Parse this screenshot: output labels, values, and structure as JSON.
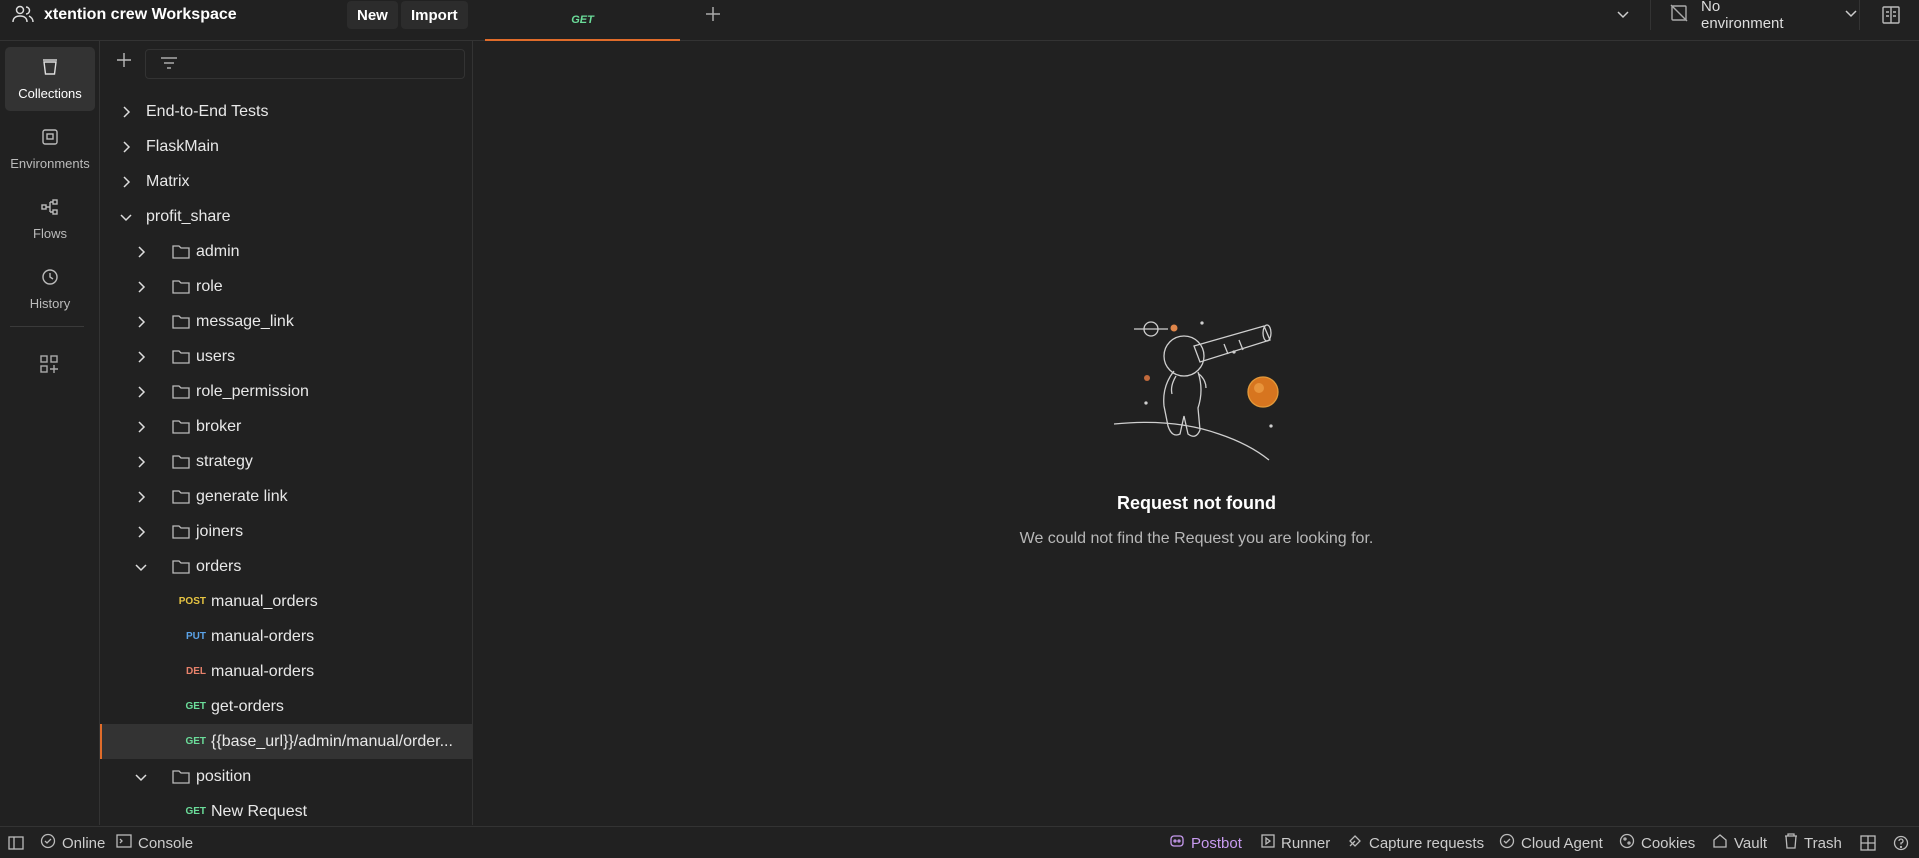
{
  "header": {
    "workspace_title": "xtention crew Workspace",
    "new_label": "New",
    "import_label": "Import",
    "active_tab_method": "GET",
    "environment_label": "No environment"
  },
  "rail": [
    {
      "label": "Collections",
      "icon": "collections-icon",
      "active": true
    },
    {
      "label": "Environments",
      "icon": "environments-icon"
    },
    {
      "label": "Flows",
      "icon": "flows-icon"
    },
    {
      "label": "History",
      "icon": "history-icon"
    }
  ],
  "tree": {
    "collections": [
      {
        "label": "End-to-End Tests"
      },
      {
        "label": "FlaskMain"
      },
      {
        "label": "Matrix"
      },
      {
        "label": "profit_share"
      }
    ],
    "folders": [
      {
        "label": "admin"
      },
      {
        "label": "role"
      },
      {
        "label": "message_link"
      },
      {
        "label": "users"
      },
      {
        "label": "role_permission"
      },
      {
        "label": "broker"
      },
      {
        "label": "strategy"
      },
      {
        "label": "generate link"
      },
      {
        "label": "joiners"
      },
      {
        "label": "orders"
      }
    ],
    "orders_requests": [
      {
        "method": "POST",
        "label": "manual_orders"
      },
      {
        "method": "PUT",
        "label": "manual-orders"
      },
      {
        "method": "DEL",
        "label": "manual-orders"
      },
      {
        "method": "GET",
        "label": "get-orders"
      },
      {
        "method": "GET",
        "label": "{{base_url}}/admin/manual/order..."
      }
    ],
    "position_folder": {
      "label": "position"
    },
    "position_requests": [
      {
        "method": "GET",
        "label": "New Request"
      }
    ]
  },
  "empty_state": {
    "title": "Request not found",
    "subtitle": "We could not find the Request you are looking for."
  },
  "status_bar": {
    "online": "Online",
    "console": "Console",
    "postbot": "Postbot",
    "runner": "Runner",
    "capture": "Capture requests",
    "cloud_agent": "Cloud Agent",
    "cookies": "Cookies",
    "vault": "Vault",
    "trash": "Trash"
  },
  "colors": {
    "accent": "#e06c2a",
    "post": "#e6c442",
    "put": "#5ba3e8",
    "del": "#e8826b",
    "get": "#6bdd9a",
    "postbot": "#c89bf0"
  }
}
